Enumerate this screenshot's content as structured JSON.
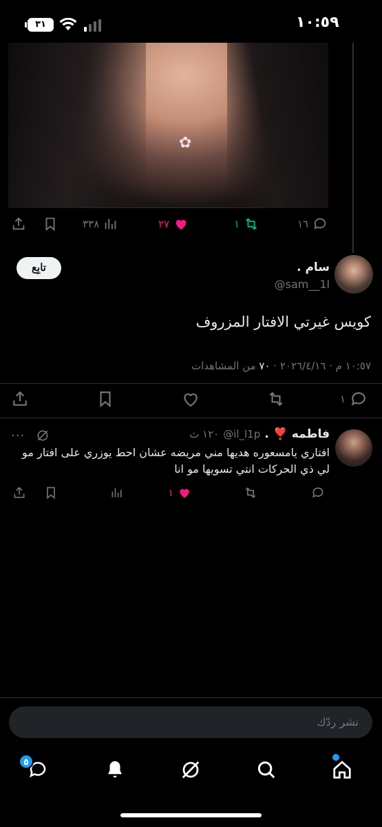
{
  "status_bar": {
    "time": "١٠:٥٩",
    "battery": "٣١"
  },
  "quoted_post": {
    "actions": {
      "share": "",
      "bookmark": "",
      "views": "٣٣٨",
      "likes": "٢٧",
      "retweets": "١",
      "replies": "١٦"
    }
  },
  "main_post": {
    "author_name": "سام .",
    "handle": "@sam__1l",
    "follow_label": "تابِع",
    "text": "كويس غيرتي الافتار المزروف",
    "date": "١٠:٥٧ م · ٢٠٢٦/٤/١٦",
    "views_count": "٧٠",
    "views_label": "من المشاهدات",
    "actions": {
      "replies": "١",
      "retweets": "",
      "likes": ""
    }
  },
  "reply": {
    "author_name": "فاطمه ❣️ .",
    "handle": "@il_l1p",
    "time": "١٢٠ ث",
    "text": "افتاري يامسعوره هديها مني مريضه عشان احط يوزري على افتار مو لي ذي الحركات انتي تسويها مو انا",
    "actions": {
      "likes": "١"
    }
  },
  "composer": {
    "placeholder": "نشر ردّك"
  },
  "bottom_nav": {
    "messages_badge": "٥"
  },
  "colors": {
    "like": "#f91880",
    "retweet": "#00ba7c",
    "accent": "#1d9bf0"
  }
}
